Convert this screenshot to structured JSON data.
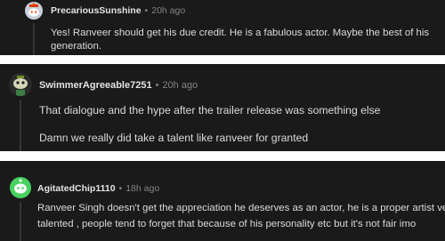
{
  "comments": [
    {
      "username": "PrecariousSunshine",
      "time": "20h ago",
      "lines": [
        "Yes! Ranveer should get his due credit. He is a fabulous actor. Maybe the best of his",
        "generation."
      ]
    },
    {
      "username": "SwimmerAgreeable7251",
      "time": "20h ago",
      "lines": [
        "That dialogue and the hype after the trailer release was something else",
        "Damn we really did take a talent like ranveer for granted"
      ]
    },
    {
      "username": "AgitatedChip1110",
      "time": "18h ago",
      "lines": [
        "Ranveer Singh doesn't get the appreciation he deserves as an actor, he is a proper artist very",
        "talented , people tend to forget that because of his personality etc but it's not fair imo"
      ]
    }
  ],
  "separator": "•",
  "colors": {
    "panel_bg": "#1a1a1b",
    "username": "#e3e3e3",
    "meta": "#818384",
    "body_text": "#d7dadc",
    "avatar1_bg": "#c7d0da",
    "avatar2_bg": "#2a2a2b",
    "avatar3_bg": "#46d160"
  },
  "icons": [
    "snoo-avatar-icon",
    "snoo-avatar-icon",
    "snoo-avatar-icon"
  ]
}
